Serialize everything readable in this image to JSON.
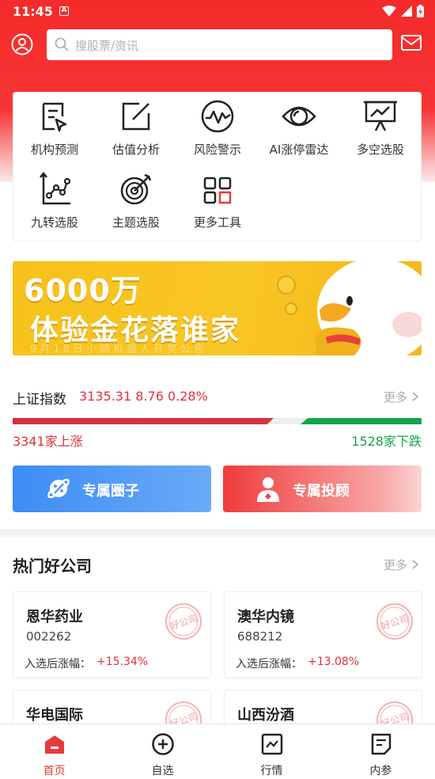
{
  "status": {
    "time": "11:45",
    "a_badge": "A"
  },
  "search": {
    "placeholder": "搜股票/资讯"
  },
  "tools": [
    {
      "label": "机构预测",
      "icon": "forecast-icon"
    },
    {
      "label": "估值分析",
      "icon": "edit-icon"
    },
    {
      "label": "风险警示",
      "icon": "risk-pulse-icon"
    },
    {
      "label": "AI涨停雷达",
      "icon": "eye-radar-icon"
    },
    {
      "label": "多空选股",
      "icon": "presentation-chart-icon"
    },
    {
      "label": "九转选股",
      "icon": "line-chart-icon"
    },
    {
      "label": "主题选股",
      "icon": "target-icon"
    },
    {
      "label": "更多工具",
      "icon": "grid-icon"
    }
  ],
  "banner": {
    "line1": "6000万",
    "line2": "体验金花落谁家",
    "line3": "9月18日小随机器人开奖公告"
  },
  "index": {
    "name": "上证指数",
    "values": "3135.31 8.76 0.28%",
    "more": "更多",
    "up_text": "3341家上涨",
    "down_text": "1528家下跌",
    "up_count": 3341,
    "down_count": 1528
  },
  "exclusive": {
    "circle": "专属圈子",
    "advisor": "专属投顾"
  },
  "hot": {
    "title": "热门好公司",
    "more": "更多",
    "stamp": "好公司",
    "label": "入选后涨幅：",
    "items": [
      {
        "name": "恩华药业",
        "code": "002262",
        "change": "+15.34%"
      },
      {
        "name": "澳华内镜",
        "code": "688212",
        "change": "+13.08%"
      },
      {
        "name": "华电国际",
        "code": ""
      },
      {
        "name": "山西汾酒",
        "code": ""
      }
    ]
  },
  "nav": [
    {
      "label": "首页",
      "active": true
    },
    {
      "label": "自选",
      "active": false
    },
    {
      "label": "行情",
      "active": false
    },
    {
      "label": "内参",
      "active": false
    }
  ],
  "colors": {
    "brand_red": "#f52a2a",
    "up_red": "#e0313b",
    "down_green": "#17a24a",
    "blue": "#3c8df5"
  }
}
